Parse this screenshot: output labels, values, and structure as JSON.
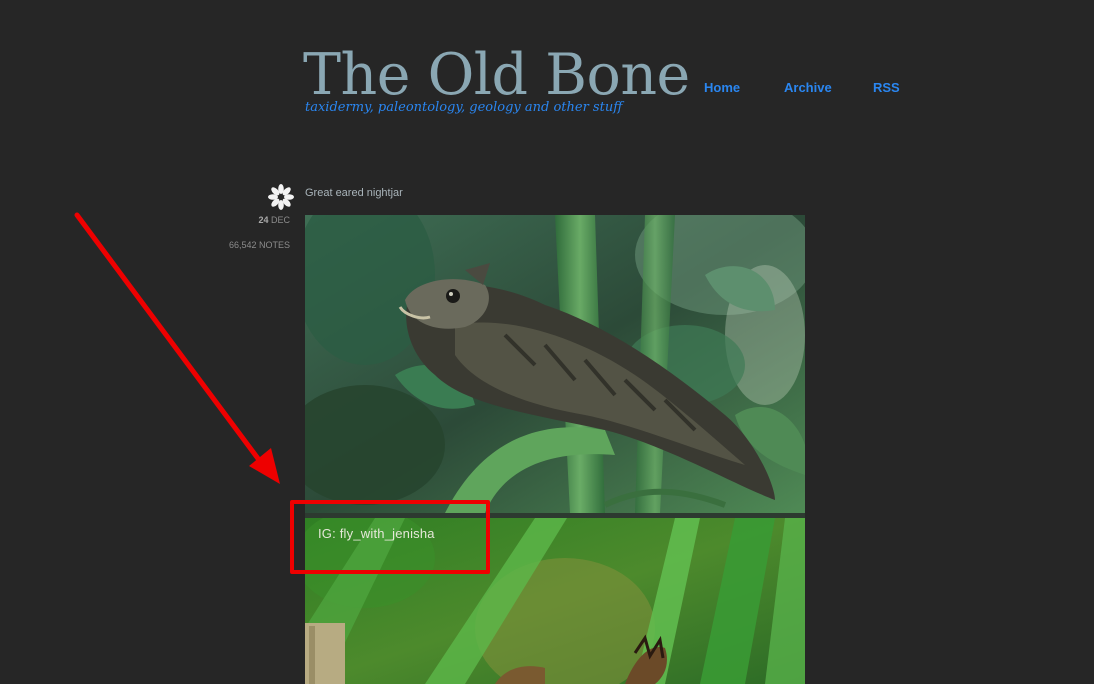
{
  "blog": {
    "title": "The Old Bone",
    "subtitle": "taxidermy, paleontology, geology and other stuff"
  },
  "nav": {
    "items": [
      {
        "label": "Home"
      },
      {
        "label": "Archive"
      },
      {
        "label": "RSS"
      }
    ]
  },
  "post": {
    "title": "Great eared nightjar",
    "date_day": "24",
    "date_month": "DEC",
    "notes": "66,542 NOTES",
    "icon": "flower-icon",
    "watermark": "IG: fly_with_jenisha"
  },
  "annotation": {
    "color": "#ee0000"
  },
  "colors": {
    "background": "#262626",
    "title": "#8aa7b3",
    "link": "#2a86f0"
  }
}
